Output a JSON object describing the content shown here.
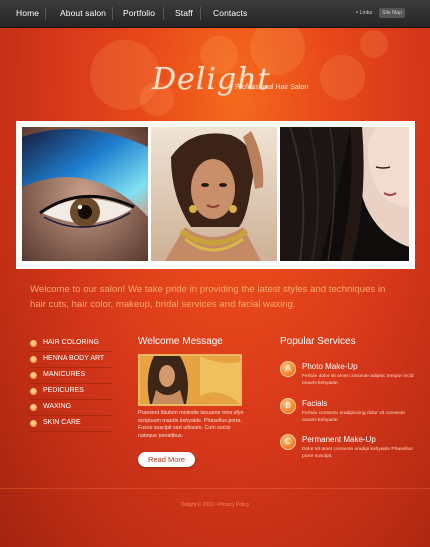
{
  "nav": {
    "items": [
      "Home",
      "About salon",
      "Portfolio",
      "Staff",
      "Contacts"
    ],
    "links_label": "• Links",
    "sitemap_label": "Site Map"
  },
  "logo": {
    "script": "Delight",
    "tagline": "Professional Hair Salon"
  },
  "intro": "Welcome to our salon! We take pride in providing the latest styles and techniques in hair cuts, hair color, makeup, bridal services and facial waxing.",
  "services": [
    "HAIR COLORING",
    "HENNA BODY ART",
    "MANICURES",
    "PEDICURES",
    "WAXING",
    "SKIN CARE"
  ],
  "welcome": {
    "title": "Welcome Message",
    "text": "Praesent tibulum molestie lacuame mira sfye scriptuum mauris kehyaide. Phasellus porta. Fusce suscipit vart uibisam. Cum sociis natoque penatibus.",
    "button": "Read More"
  },
  "popular": {
    "title": "Popular Services",
    "items": [
      {
        "badge": "A",
        "name": "Photo Make-Up",
        "desc": "Fertuie dolor sit amet consecte adipisc tempor incid mauris kehyaide."
      },
      {
        "badge": "B",
        "name": "Facials",
        "desc": "Fertuie consectu eradipiscing dolor sit consecte mauris kehyaide."
      },
      {
        "badge": "C",
        "name": "Permanent Make-Up",
        "desc": "Dolor sit amet consecte eradipi kehyaide Phasellus porre suscipit."
      }
    ]
  },
  "footer": "Delight © 2012 • Privacy Policy",
  "colors": {
    "accent": "#e8491a",
    "nav_bg": "#2e2e2e",
    "intro_text": "#f9a86f",
    "bullet": "#f08a22"
  }
}
